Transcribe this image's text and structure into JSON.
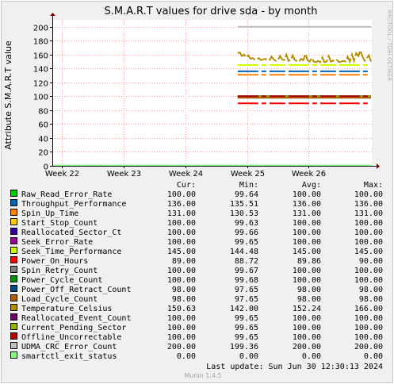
{
  "chart_data": {
    "type": "line",
    "title": "S.M.A.R.T values for drive sda - by month",
    "ylabel": "Attribute S.M.A.R.T value",
    "xlabel": "",
    "ylim": [
      0,
      210
    ],
    "yticks": [
      0,
      20,
      40,
      60,
      80,
      100,
      120,
      140,
      160,
      180,
      200
    ],
    "ytick_labels": [
      "0",
      "20",
      "40",
      "60",
      "80",
      "100",
      "120",
      "140",
      "160",
      "180",
      "200"
    ],
    "x_tick_labels": [
      "Week 22",
      "Week 23",
      "Week 24",
      "Week 25",
      "Week 26"
    ],
    "x_tick_positions": [
      22,
      23,
      24,
      25,
      26
    ],
    "xlim": [
      21.85,
      27.02
    ],
    "data_start": 24.85,
    "grid": true,
    "legend_position": "bottom",
    "columns": [
      "Cur:",
      "Min:",
      "Avg:",
      "Max:"
    ],
    "series": [
      {
        "name": "Raw_Read_Error_Rate",
        "color": "#00cc00",
        "cur": "100.00",
        "min": "99.64",
        "avg": "100.00",
        "max": "100.00",
        "value": 100
      },
      {
        "name": "Throughput_Performance",
        "color": "#0066b3",
        "cur": "136.00",
        "min": "135.51",
        "avg": "136.00",
        "max": "136.00",
        "value": 136
      },
      {
        "name": "Spin_Up_Time",
        "color": "#ff8000",
        "cur": "131.00",
        "min": "130.53",
        "avg": "131.00",
        "max": "131.00",
        "value": 131
      },
      {
        "name": "Start_Stop_Count",
        "color": "#ffcc00",
        "cur": "100.00",
        "min": "99.63",
        "avg": "100.00",
        "max": "100.00",
        "value": 100
      },
      {
        "name": "Reallocated_Sector_Ct",
        "color": "#330099",
        "cur": "100.00",
        "min": "99.66",
        "avg": "100.00",
        "max": "100.00",
        "value": 100
      },
      {
        "name": "Seek_Error_Rate",
        "color": "#990099",
        "cur": "100.00",
        "min": "99.65",
        "avg": "100.00",
        "max": "100.00",
        "value": 100
      },
      {
        "name": "Seek_Time_Performance",
        "color": "#ccff00",
        "cur": "145.00",
        "min": "144.48",
        "avg": "145.00",
        "max": "145.00",
        "value": 145
      },
      {
        "name": "Power_On_Hours",
        "color": "#ff0000",
        "cur": "89.00",
        "min": "88.72",
        "avg": "89.86",
        "max": "90.00",
        "value": 89.86
      },
      {
        "name": "Spin_Retry_Count",
        "color": "#808080",
        "cur": "100.00",
        "min": "99.67",
        "avg": "100.00",
        "max": "100.00",
        "value": 100
      },
      {
        "name": "Power_Cycle_Count",
        "color": "#008f00",
        "cur": "100.00",
        "min": "99.68",
        "avg": "100.00",
        "max": "100.00",
        "value": 100
      },
      {
        "name": "Power_Off_Retract_Count",
        "color": "#00487d",
        "cur": "98.00",
        "min": "97.65",
        "avg": "98.00",
        "max": "98.00",
        "value": 98
      },
      {
        "name": "Load_Cycle_Count",
        "color": "#b35a00",
        "cur": "98.00",
        "min": "97.65",
        "avg": "98.00",
        "max": "98.00",
        "value": 98
      },
      {
        "name": "Temperature_Celsius",
        "color": "#b38f00",
        "cur": "150.63",
        "min": "142.00",
        "avg": "152.24",
        "max": "166.00",
        "value": 152.24
      },
      {
        "name": "Reallocated_Event_Count",
        "color": "#6b006b",
        "cur": "100.00",
        "min": "99.65",
        "avg": "100.00",
        "max": "100.00",
        "value": 100
      },
      {
        "name": "Current_Pending_Sector",
        "color": "#8fb300",
        "cur": "100.00",
        "min": "99.65",
        "avg": "100.00",
        "max": "100.00",
        "value": 100
      },
      {
        "name": "Offline_Uncorrectable",
        "color": "#b30000",
        "cur": "100.00",
        "min": "99.65",
        "avg": "100.00",
        "max": "100.00",
        "value": 100
      },
      {
        "name": "UDMA_CRC_Error_Count",
        "color": "#bebebe",
        "cur": "200.00",
        "min": "199.36",
        "avg": "200.00",
        "max": "200.00",
        "value": 200
      },
      {
        "name": "smartctl_exit_status",
        "color": "#80ff80",
        "cur": "0.00",
        "min": "0.00",
        "avg": "0.00",
        "max": "0.00",
        "value": 0
      }
    ],
    "temperature_trace": [
      162,
      163,
      158,
      160,
      156,
      159,
      154,
      155,
      153,
      153,
      155,
      152,
      153,
      154,
      152,
      152,
      157,
      153,
      151,
      152,
      158,
      153,
      152,
      160,
      151,
      152,
      159,
      152,
      151,
      150,
      154,
      152,
      161,
      152,
      150,
      155,
      150,
      149,
      151,
      149,
      156,
      149,
      150,
      158,
      150,
      151,
      153,
      152,
      149,
      150,
      151,
      150,
      157,
      150,
      160,
      151,
      162,
      158,
      166,
      157,
      151,
      155,
      159,
      150
    ]
  },
  "last_update": "Last update:  Sun Jun 30 12:30:13 2024",
  "watermark": "RRDTOOL / TOBI OETIKER",
  "footer": "Munin 1.4.5"
}
